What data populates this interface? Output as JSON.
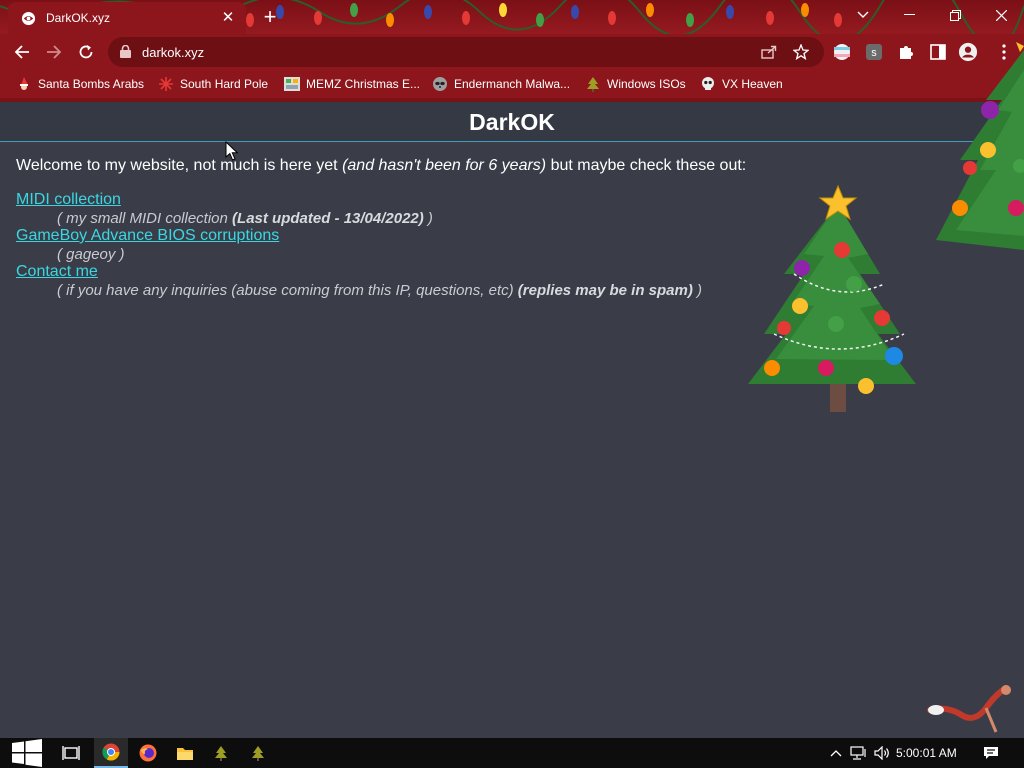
{
  "browser": {
    "tab_title": "DarkOK.xyz",
    "url": "darkok.xyz",
    "bookmarks": [
      {
        "label": "Santa Bombs Arabs",
        "icon": "santa-icon"
      },
      {
        "label": "South Hard Pole",
        "icon": "snowflake-icon"
      },
      {
        "label": "MEMZ Christmas E...",
        "icon": "memz-icon"
      },
      {
        "label": "Endermanch Malwa...",
        "icon": "raccoon-icon"
      },
      {
        "label": "Windows ISOs",
        "icon": "tree-icon"
      },
      {
        "label": "VX Heaven",
        "icon": "skull-icon"
      }
    ]
  },
  "page": {
    "title": "DarkOK",
    "intro_start": "Welcome to my website, not much is here yet ",
    "intro_italic": "(and hasn't been for 6 years)",
    "intro_end": " but maybe check these out:",
    "links": [
      {
        "label": "MIDI collection",
        "desc_open": "( my small MIDI collection ",
        "desc_bold": "(Last updated - 13/04/2022)",
        "desc_close": " )"
      },
      {
        "label": "GameBoy Advance BIOS corruptions",
        "desc_open": "( gageoy )",
        "desc_bold": "",
        "desc_close": ""
      },
      {
        "label": "Contact me",
        "desc_open": "( if you have any inquiries (abuse coming from this IP, questions, etc) ",
        "desc_bold": "(replies may be in spam)",
        "desc_close": " )"
      }
    ]
  },
  "taskbar": {
    "clock": "5:00:01 AM"
  },
  "colors": {
    "chrome_red": "#8d161c",
    "page_bg": "#3a3d48",
    "link": "#3ad7e2",
    "header_line": "#3e9fbd"
  }
}
